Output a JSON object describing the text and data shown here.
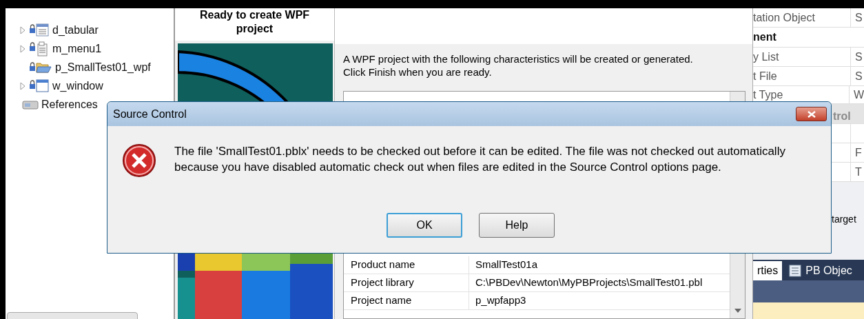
{
  "tree": {
    "items": [
      {
        "label": "d_tabular",
        "kind": "datawindow",
        "expandable": true
      },
      {
        "label": "m_menu1",
        "kind": "menu",
        "expandable": true
      },
      {
        "label": "p_SmallTest01_wpf",
        "kind": "project",
        "expandable": false
      },
      {
        "label": "w_window",
        "kind": "window",
        "expandable": true
      },
      {
        "label": "References",
        "kind": "references",
        "expandable": false
      }
    ]
  },
  "wizard": {
    "heading": "Ready to create WPF project",
    "intro": "A WPF project with the following characteristics will be created or generated.\nClick Finish when you are ready.",
    "rows": [
      {
        "name": "Product name",
        "value": "SmallTest01a"
      },
      {
        "name": "Project library",
        "value": "C:\\PBDev\\Newton\\MyPBProjects\\SmallTest01.pbl"
      },
      {
        "name": "Project name",
        "value": "p_wpfapp3"
      }
    ]
  },
  "properties": {
    "rows": [
      {
        "kind": "property",
        "name": "tation Object",
        "value": "S"
      },
      {
        "kind": "category",
        "name": "nent",
        "disabled": false
      },
      {
        "kind": "property",
        "name": "y List",
        "value": "S"
      },
      {
        "kind": "property",
        "name": "t File",
        "value": "S"
      },
      {
        "kind": "property",
        "name": "t Type",
        "value": "W"
      },
      {
        "kind": "category",
        "name": "trol",
        "disabled": true
      },
      {
        "kind": "property"
      },
      {
        "kind": "property",
        "value": "F"
      },
      {
        "kind": "property",
        "value": "T"
      }
    ],
    "lower_label": "target",
    "tabs": [
      {
        "label": "rties",
        "selected": true
      },
      {
        "label": "PB Objec",
        "selected": false
      }
    ]
  },
  "dialog": {
    "title": "Source Control",
    "message": "The file 'SmallTest01.pblx' needs to be checked out before it can be edited. The file was not checked out automatically because you have disabled automatic check out when files are edited in the Source Control options page.",
    "buttons": [
      {
        "label": "OK",
        "selected": true
      },
      {
        "label": "Help",
        "selected": false
      }
    ]
  }
}
